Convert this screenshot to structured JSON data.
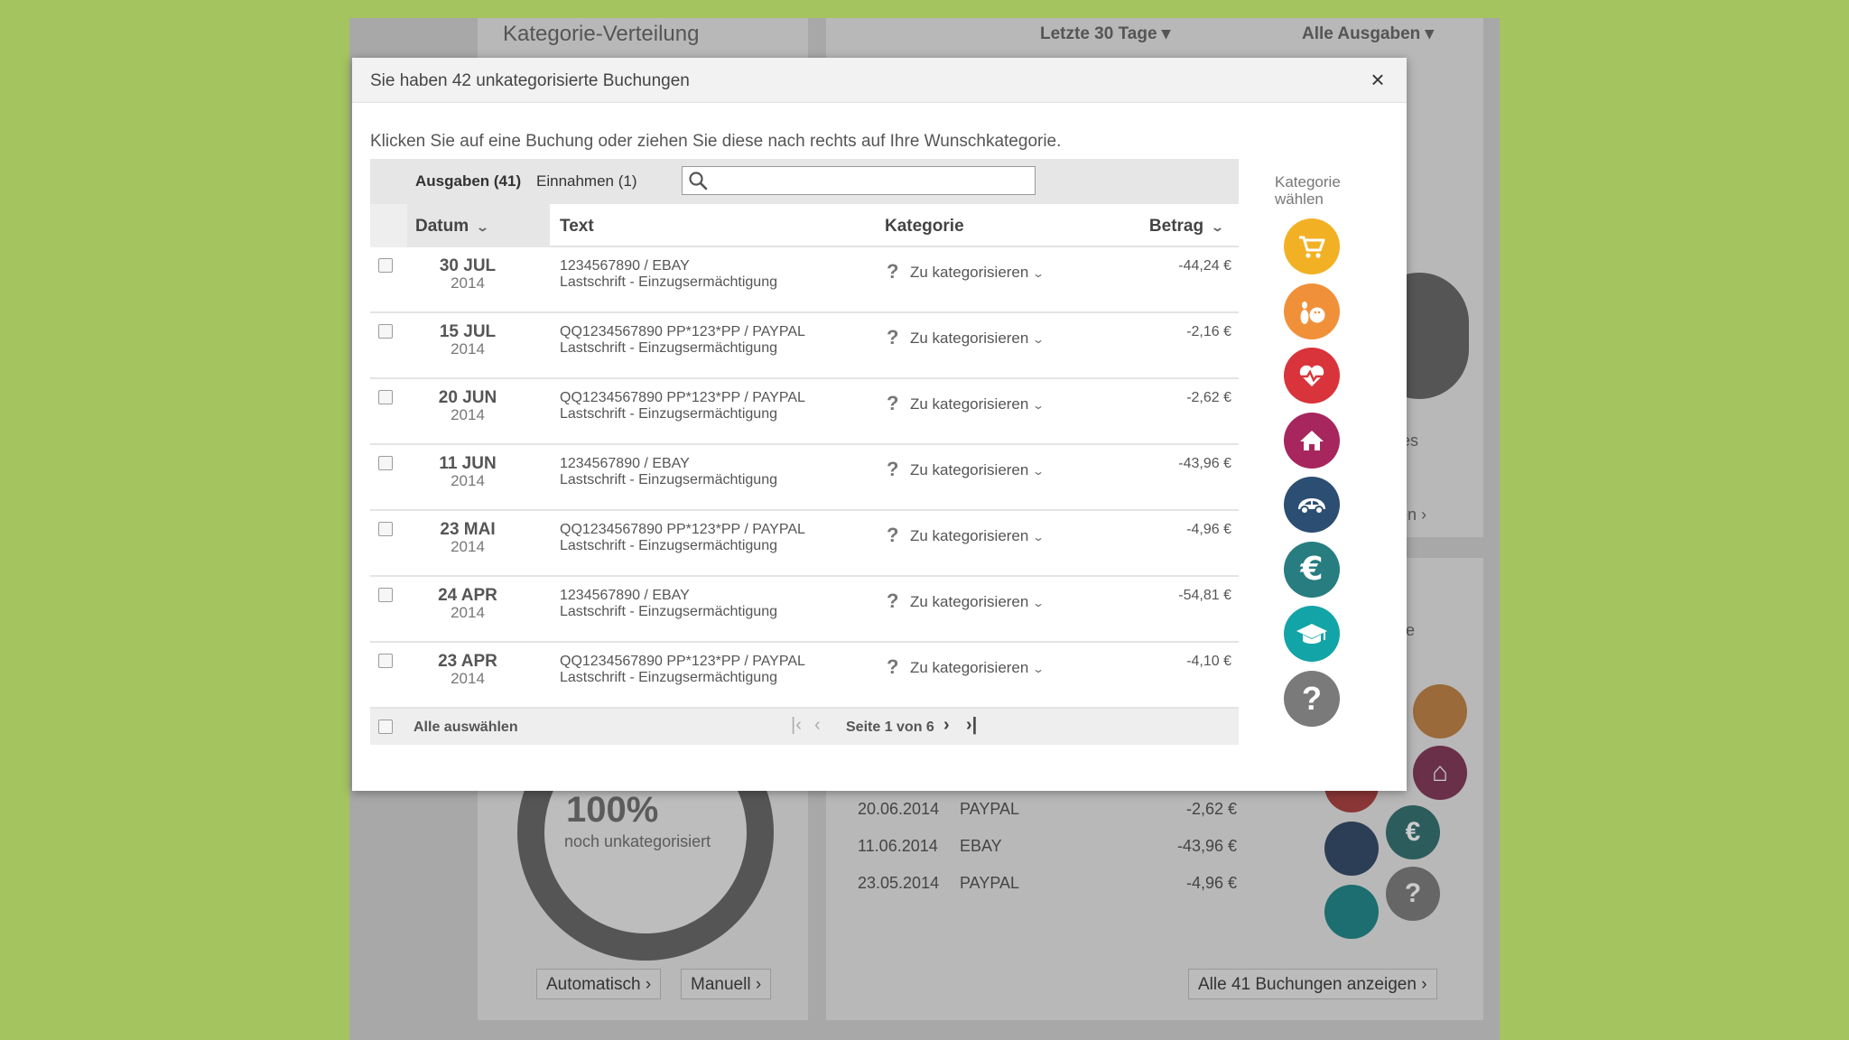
{
  "background": {
    "title": "Kategorie-Verteilung",
    "period": "Letzte 30 Tage",
    "filter": "Alle Ausgaben",
    "donut_value": "100%",
    "donut_label": "noch unkategorisiert",
    "btn_auto": "Automatisch",
    "btn_manual": "Manuell",
    "btn_all": "Alle 41 Buchungen anzeigen",
    "partial_es": "es",
    "partial_en": "en",
    "partial_e": "e",
    "rows": [
      {
        "date": "20.06.2014",
        "merchant": "PAYPAL",
        "amount": "-2,62 €"
      },
      {
        "date": "11.06.2014",
        "merchant": "EBAY",
        "amount": "-43,96 €"
      },
      {
        "date": "23.05.2014",
        "merchant": "PAYPAL",
        "amount": "-4,96 €"
      }
    ]
  },
  "modal": {
    "title": "Sie haben 42 unkategorisierte Buchungen",
    "close_symbol": "×",
    "instructions": "Klicken Sie auf eine Buchung oder ziehen Sie diese nach rechts auf Ihre Wunschkategorie.",
    "tabs": {
      "expenses": "Ausgaben (41)",
      "income": "Einnahmen (1)"
    },
    "search": {
      "value": "",
      "placeholder": ""
    },
    "columns": {
      "date": "Datum",
      "text": "Text",
      "category": "Kategorie",
      "amount": "Betrag"
    },
    "transactions": [
      {
        "day": "30 JUL",
        "year": "2014",
        "desc": "1234567890 / EBAY",
        "type": "Lastschrift - Einzugsermächtigung",
        "category": "Zu kategorisieren",
        "amount": "-44,24 €"
      },
      {
        "day": "15 JUL",
        "year": "2014",
        "desc": "QQ1234567890 PP*123*PP / PAYPAL",
        "type": "Lastschrift - Einzugsermächtigung",
        "category": "Zu kategorisieren",
        "amount": "-2,16 €"
      },
      {
        "day": "20 JUN",
        "year": "2014",
        "desc": "QQ1234567890 PP*123*PP / PAYPAL",
        "type": "Lastschrift - Einzugsermächtigung",
        "category": "Zu kategorisieren",
        "amount": "-2,62 €"
      },
      {
        "day": "11 JUN",
        "year": "2014",
        "desc": "1234567890 / EBAY",
        "type": "Lastschrift - Einzugsermächtigung",
        "category": "Zu kategorisieren",
        "amount": "-43,96 €"
      },
      {
        "day": "23 MAI",
        "year": "2014",
        "desc": "QQ1234567890 PP*123*PP / PAYPAL",
        "type": "Lastschrift - Einzugsermächtigung",
        "category": "Zu kategorisieren",
        "amount": "-4,96 €"
      },
      {
        "day": "24 APR",
        "year": "2014",
        "desc": "1234567890 / EBAY",
        "type": "Lastschrift - Einzugsermächtigung",
        "category": "Zu kategorisieren",
        "amount": "-54,81 €"
      },
      {
        "day": "23 APR",
        "year": "2014",
        "desc": "QQ1234567890 PP*123*PP / PAYPAL",
        "type": "Lastschrift - Einzugsermächtigung",
        "category": "Zu kategorisieren",
        "amount": "-4,10 €"
      }
    ],
    "footer": {
      "select_all": "Alle auswählen",
      "page_info": "Seite 1 von 6"
    },
    "category_panel": {
      "heading_line1": "Kategorie",
      "heading_line2": "wählen",
      "categories": [
        {
          "icon": "shopping-cart-icon",
          "color": "#f2b125"
        },
        {
          "icon": "bowling-icon",
          "color": "#f0913a"
        },
        {
          "icon": "heart-pulse-icon",
          "color": "#d9343b"
        },
        {
          "icon": "house-icon",
          "color": "#a6265d"
        },
        {
          "icon": "car-icon",
          "color": "#2c4e72"
        },
        {
          "icon": "euro-icon",
          "color": "#277d7f"
        },
        {
          "icon": "graduation-cap-icon",
          "color": "#13a4a8"
        },
        {
          "icon": "question-icon",
          "color": "#7a7a7a"
        }
      ]
    }
  }
}
